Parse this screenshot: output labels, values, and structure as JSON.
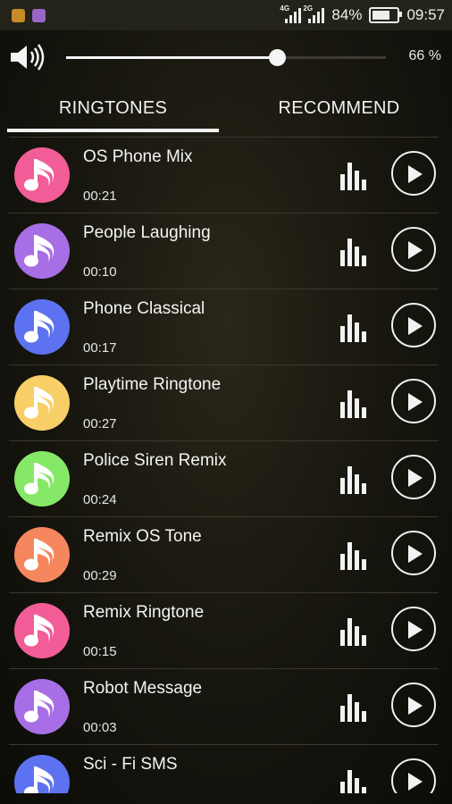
{
  "status_bar": {
    "network_1": "4G",
    "network_2": "2G",
    "battery": "84%",
    "battery_level": 0.84,
    "time": "09:57",
    "notification_colors": [
      "#c98a2a",
      "#9a66c8"
    ]
  },
  "volume": {
    "icon": "speaker-icon",
    "value_label": "66 %",
    "level": 0.66
  },
  "tabs": [
    {
      "label": "RINGTONES",
      "active": true
    },
    {
      "label": "RECOMMEND",
      "active": false
    }
  ],
  "ringtones": [
    {
      "title": "OS Phone Mix",
      "duration": "00:21",
      "color": "#f25d97"
    },
    {
      "title": "People Laughing",
      "duration": "00:10",
      "color": "#a86ee6"
    },
    {
      "title": "Phone Classical",
      "duration": "00:17",
      "color": "#5d72f0"
    },
    {
      "title": "Playtime Ringtone",
      "duration": "00:27",
      "color": "#f8cf67"
    },
    {
      "title": "Police Siren Remix",
      "duration": "00:24",
      "color": "#85e866"
    },
    {
      "title": "Remix OS Tone",
      "duration": "00:29",
      "color": "#f5865d"
    },
    {
      "title": "Remix Ringtone",
      "duration": "00:15",
      "color": "#f25d97"
    },
    {
      "title": "Robot Message",
      "duration": "00:03",
      "color": "#a86ee6"
    },
    {
      "title": "Sci - Fi SMS",
      "duration": "",
      "color": "#5d72f0"
    }
  ]
}
